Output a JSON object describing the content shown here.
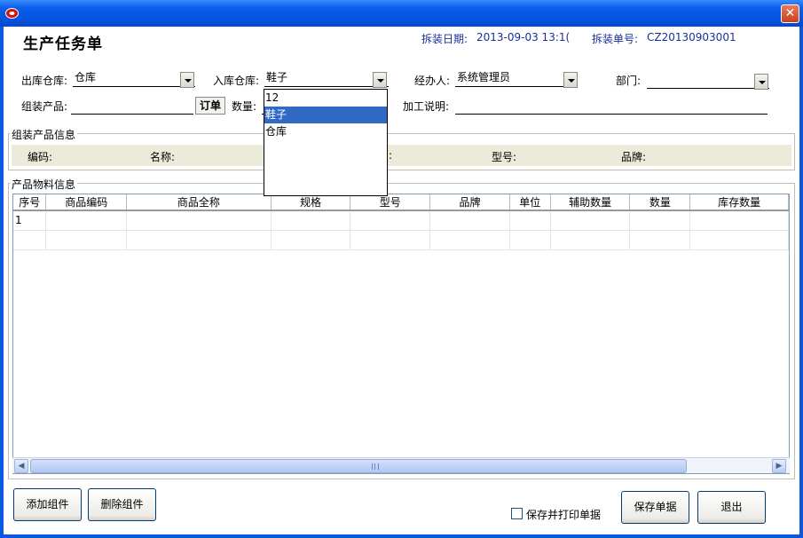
{
  "window": {
    "close_symbol": "✕"
  },
  "header": {
    "title": "生产任务单",
    "date_label": "拆装日期:",
    "date_value": "2013-09-03 13:1(",
    "order_no_label": "拆装单号:",
    "order_no_value": "CZ20130903001"
  },
  "form": {
    "out_warehouse_label": "出库仓库:",
    "out_warehouse_value": "仓库",
    "in_warehouse_label": "入库仓库:",
    "in_warehouse_value": "鞋子",
    "handler_label": "经办人:",
    "handler_value": "系统管理员",
    "dept_label": "部门:",
    "dept_value": "",
    "product_label": "组装产品:",
    "product_value": "",
    "order_button": "订单",
    "qty_label": "数量:",
    "process_note_label": "加工说明:",
    "process_note_value": ""
  },
  "dropdown": {
    "options": [
      "12",
      "鞋子",
      "仓库"
    ],
    "selected_index": 1
  },
  "assembly_info": {
    "title": "组装产品信息",
    "code_label": "编码:",
    "name_label": "名称:",
    "hidden_label": ":",
    "model_label": "型号:",
    "brand_label": "品牌:"
  },
  "materials": {
    "title": "产品物料信息",
    "columns": [
      "序号",
      "商品编码",
      "商品全称",
      "规格",
      "型号",
      "品牌",
      "单位",
      "辅助数量",
      "数量",
      "库存数量"
    ],
    "rows": [
      [
        "1",
        "",
        "",
        "",
        "",
        "",
        "",
        "",
        "",
        ""
      ],
      [
        "",
        "",
        "",
        "",
        "",
        "",
        "",
        "",
        "",
        ""
      ]
    ]
  },
  "footer": {
    "add_component": "添加组件",
    "delete_component": "删除组件",
    "save_print_label": "保存并打印单据",
    "save_print_checked": false,
    "save_button": "保存单据",
    "exit_button": "退出"
  }
}
